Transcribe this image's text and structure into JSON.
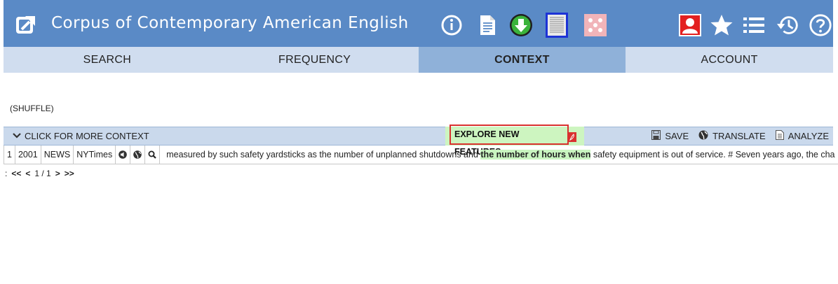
{
  "header": {
    "title": "Corpus of Contemporary American English",
    "icons": [
      "external-link-icon",
      "info-icon",
      "document-icon",
      "download-icon",
      "texts-icon",
      "dice-icon",
      "user-icon",
      "star-icon",
      "list-icon",
      "history-icon",
      "help-icon"
    ],
    "accent": "#5a8ac6"
  },
  "tabs": [
    {
      "label": "SEARCH"
    },
    {
      "label": "FREQUENCY"
    },
    {
      "label": "CONTEXT",
      "active": true
    },
    {
      "label": "ACCOUNT"
    }
  ],
  "shuffle_label": "(SHUFFLE)",
  "context_bar": {
    "more_label": "CLICK FOR MORE CONTEXT",
    "explore_label": "EXPLORE NEW FEATURES",
    "save_label": "SAVE",
    "translate_label": "TRANSLATE",
    "analyze_label": "ANALYZE"
  },
  "result": {
    "num": "1",
    "year": "2001",
    "genre": "NEWS",
    "source": "NYTimes",
    "pre": "measured by such safety yardsticks as the number of unplanned shutdowns and",
    "hit": "the number of hours when",
    "post": "safety equipment is out of service. # Seven years ago, the cha"
  },
  "pager": {
    "colon": ":",
    "first": "<<",
    "prev": "<",
    "pages": "1 / 1",
    "next": ">",
    "last": ">>"
  }
}
